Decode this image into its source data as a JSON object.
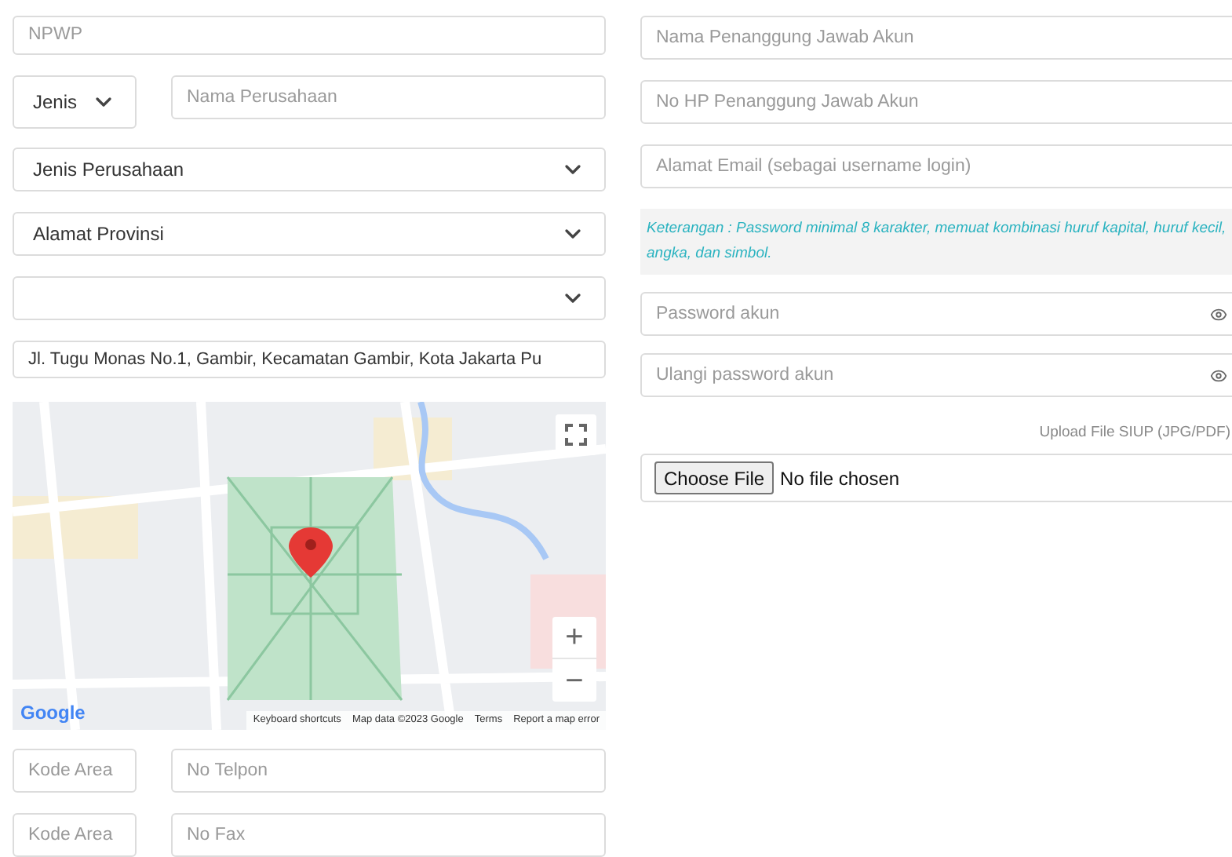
{
  "left": {
    "npwp": {
      "placeholder": "NPWP"
    },
    "entity_type": {
      "value": "Jenis"
    },
    "company_name": {
      "placeholder": "Nama Perusahaan"
    },
    "company_type": {
      "value": "Jenis Perusahaan"
    },
    "province": {
      "value": "Alamat Provinsi"
    },
    "address": {
      "value": "Jl. Tugu Monas No.1, Gambir, Kecamatan Gambir, Kota Jakarta Pu"
    },
    "map": {
      "logo": "Google",
      "zoom_in": "+",
      "zoom_out": "−",
      "footer": [
        "Keyboard shortcuts",
        "Map data ©2023 Google",
        "Terms",
        "Report a map error"
      ]
    },
    "phone": {
      "area_placeholder": "Kode Area",
      "number_placeholder": "No Telpon"
    },
    "fax": {
      "area_placeholder": "Kode Area",
      "number_placeholder": "No Fax"
    }
  },
  "right": {
    "fields": [
      {
        "placeholder": "Nama Penanggung Jawab Akun"
      },
      {
        "placeholder": "No HP Penanggung Jawab Akun"
      },
      {
        "placeholder": "Alamat Email (sebagai username login)"
      }
    ],
    "note": "Keterangan : Password minimal 8 karakter, memuat kombinasi huruf kapital, huruf kecil, angka, dan simbol.",
    "passwords": [
      {
        "placeholder": "Password akun"
      },
      {
        "placeholder": "Ulangi password akun"
      }
    ],
    "upload_label": "Upload File SIUP (JPG/PDF)",
    "file": {
      "button": "Choose File",
      "status": "No file chosen"
    }
  }
}
